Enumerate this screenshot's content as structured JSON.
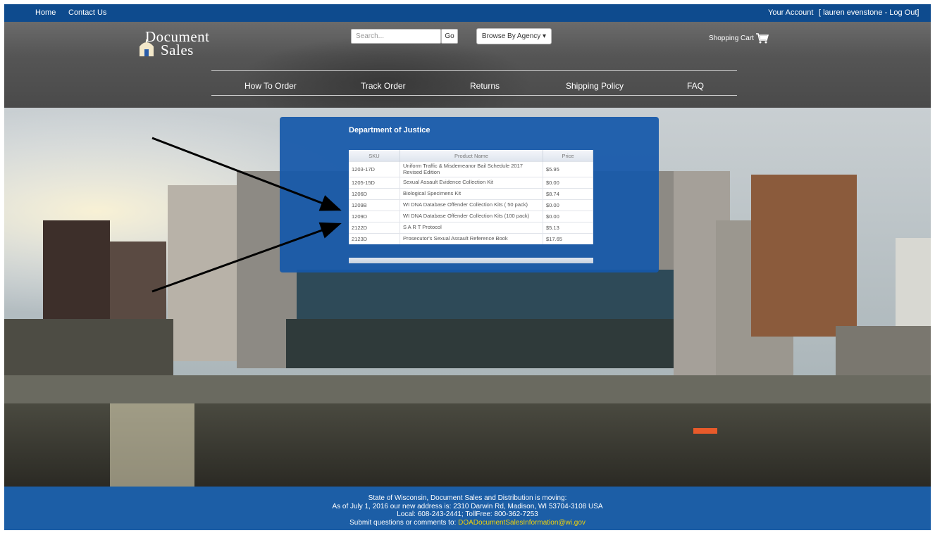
{
  "topbar": {
    "home": "Home",
    "contact": "Contact Us",
    "account": "Your Account",
    "user": "[ lauren evenstone - Log Out]"
  },
  "logo": {
    "line1": "Document",
    "line2": "Sales"
  },
  "search": {
    "placeholder": "Search...",
    "go": "Go"
  },
  "browse": {
    "label": "Browse By Agency ▾"
  },
  "cart": {
    "label": "Shopping Cart"
  },
  "nav": [
    "How To Order",
    "Track Order",
    "Returns",
    "Shipping Policy",
    "FAQ"
  ],
  "panel": {
    "title": "Department of Justice",
    "columns": [
      "SKU",
      "Product Name",
      "Price"
    ],
    "rows": [
      {
        "sku": "1203-17D",
        "name": "Uniform Traffic & Misdemeanor Bail Schedule 2017 Revised Edition",
        "price": "$5.95"
      },
      {
        "sku": "1205-15D",
        "name": "Sexual Assault Evidence Collection Kit",
        "price": "$0.00"
      },
      {
        "sku": "1206D",
        "name": "Biological Specimens Kit",
        "price": "$8.74"
      },
      {
        "sku": "1209B",
        "name": "WI DNA Database Offender Collection Kits ( 50 pack)",
        "price": "$0.00"
      },
      {
        "sku": "1209D",
        "name": "WI DNA Database Offender Collection Kits (100 pack)",
        "price": "$0.00"
      },
      {
        "sku": "2122D",
        "name": "S A R T Protocol",
        "price": "$5.13"
      },
      {
        "sku": "2123D",
        "name": "Prosecutor's Sexual Assault Reference Book",
        "price": "$17.65"
      }
    ]
  },
  "footer": {
    "line1": "State of Wisconsin, Document Sales and Distribution is moving:",
    "line2": "As of July 1, 2016 our new address is: 2310 Darwin Rd, Madison, WI 53704-3108 USA",
    "line3": "Local: 608-243-2441; TollFree: 800-362-7253",
    "line4_prefix": "Submit questions or comments to:",
    "email": "DOADocumentSalesInformation@wi.gov"
  },
  "colors": {
    "topbar": "#0e4b8e",
    "panel": "#1658aa",
    "footer": "#1c5ea6",
    "link_highlight": "#f1d20a"
  }
}
